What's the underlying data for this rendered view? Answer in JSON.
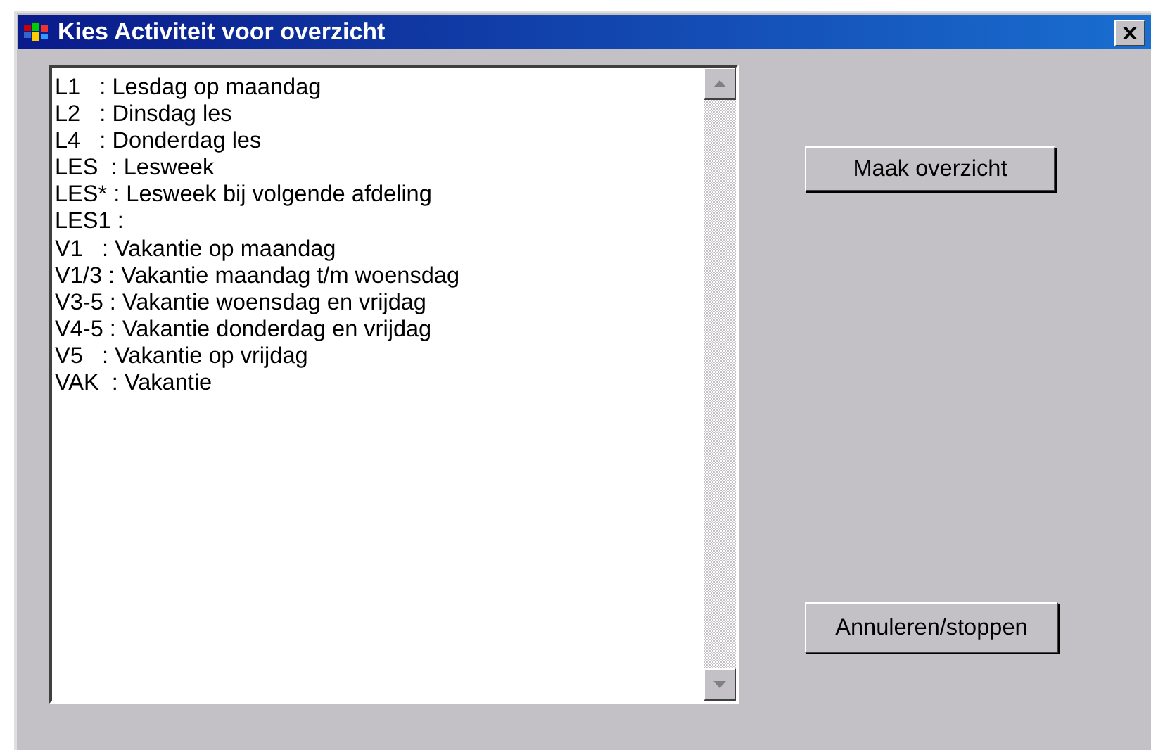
{
  "window": {
    "title": "Kies Activiteit voor overzicht"
  },
  "activities": [
    {
      "text": "L1   : Lesdag op maandag"
    },
    {
      "text": "L2   : Dinsdag les"
    },
    {
      "text": "L4   : Donderdag les"
    },
    {
      "text": "LES  : Lesweek"
    },
    {
      "text": "LES* : Lesweek bij volgende afdeling"
    },
    {
      "text": "LES1 :"
    },
    {
      "text": "V1   : Vakantie op maandag"
    },
    {
      "text": "V1/3 : Vakantie maandag t/m woensdag"
    },
    {
      "text": "V3-5 : Vakantie woensdag en vrijdag"
    },
    {
      "text": "V4-5 : Vakantie donderdag en vrijdag"
    },
    {
      "text": "V5   : Vakantie op vrijdag"
    },
    {
      "text": "VAK  : Vakantie"
    }
  ],
  "buttons": [
    {
      "label": "Maak overzicht"
    },
    {
      "label": "Annuleren/stoppen"
    }
  ]
}
